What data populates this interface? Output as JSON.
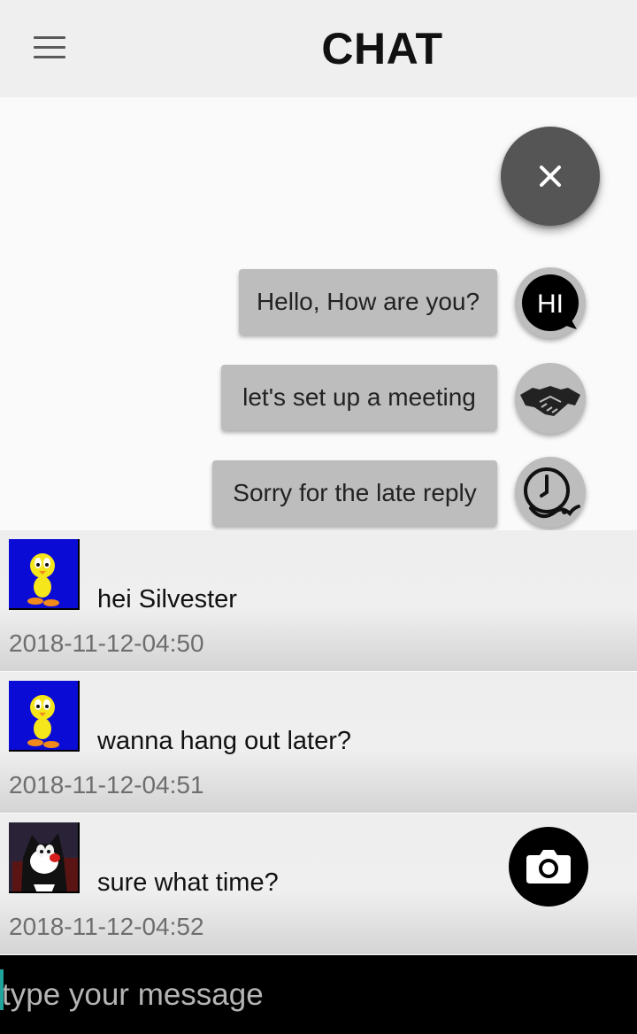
{
  "header": {
    "title": "CHAT",
    "menu_icon": "hamburger-menu-icon"
  },
  "fab_menu": {
    "close_icon": "close-icon",
    "options": [
      {
        "label": "Hello, How are you?",
        "icon": "hi-speech-bubble-icon"
      },
      {
        "label": "let's set up a meeting",
        "icon": "handshake-icon"
      },
      {
        "label": "Sorry for the late reply",
        "icon": "clock-icon"
      }
    ]
  },
  "messages": [
    {
      "avatar": "tweety-avatar",
      "text": "hei Silvester",
      "time": "2018-11-12-04:50"
    },
    {
      "avatar": "tweety-avatar",
      "text": "wanna hang out later?",
      "time": "2018-11-12-04:51"
    },
    {
      "avatar": "sylvester-avatar",
      "text": "sure what time?",
      "time": "2018-11-12-04:52"
    }
  ],
  "camera_button": {
    "icon": "camera-icon"
  },
  "composer": {
    "placeholder": "type your message",
    "value": ""
  },
  "colors": {
    "app_bar": "#efefef",
    "fab_close": "#555555",
    "quick_reply": "#bdbdbd",
    "input_bar": "#000000",
    "cursor_accent": "#1fa39a"
  }
}
